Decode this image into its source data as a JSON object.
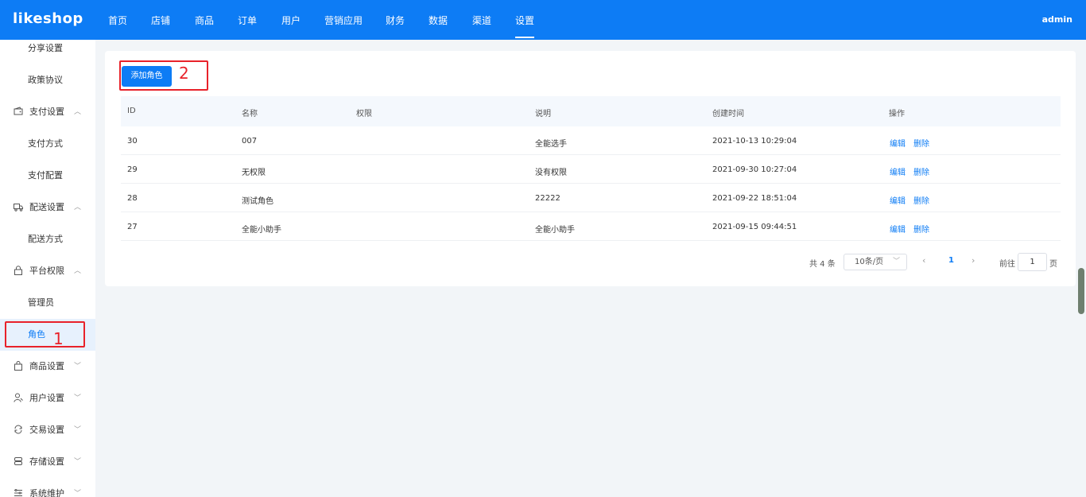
{
  "header": {
    "logo": "likeshop",
    "nav": [
      "首页",
      "店铺",
      "商品",
      "订单",
      "用户",
      "营销应用",
      "财务",
      "数据",
      "渠道",
      "设置"
    ],
    "user": "admin"
  },
  "sidebar": {
    "share": "分享设置",
    "policy": "政策协议",
    "pay_group": "支付设置",
    "pay_method": "支付方式",
    "pay_config": "支付配置",
    "delivery_group": "配送设置",
    "delivery_method": "配送方式",
    "perm_group": "平台权限",
    "admin": "管理员",
    "role": "角色",
    "goods_group": "商品设置",
    "user_group": "用户设置",
    "trade_group": "交易设置",
    "storage_group": "存储设置",
    "system_group": "系统维护"
  },
  "annotations": {
    "one": "1",
    "two": "2"
  },
  "toolbar": {
    "add_role": "添加角色"
  },
  "table": {
    "columns": [
      "ID",
      "名称",
      "权限",
      "说明",
      "创建时间",
      "操作"
    ],
    "rows": [
      {
        "id": "30",
        "name": "007",
        "desc": "全能选手",
        "created": "2021-10-13 10:29:04"
      },
      {
        "id": "29",
        "name": "无权限",
        "desc": "没有权限",
        "created": "2021-09-30 10:27:04"
      },
      {
        "id": "28",
        "name": "测试角色",
        "desc": "22222",
        "created": "2021-09-22 18:51:04"
      },
      {
        "id": "27",
        "name": "全能小助手",
        "desc": "全能小助手",
        "created": "2021-09-15 09:44:51"
      }
    ],
    "edit": "编辑",
    "delete": "删除"
  },
  "pagination": {
    "total": "共 4 条",
    "page_size": "10条/页",
    "current": "1",
    "goto_label": "前往",
    "goto_value": "1",
    "page_unit": "页"
  },
  "colors": {
    "primary": "#0d7cf5",
    "annotation": "#e8222a"
  }
}
